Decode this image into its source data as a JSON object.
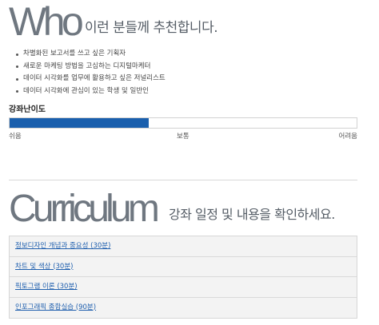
{
  "who": {
    "big_word": "Who",
    "subtitle": "이런 분들께 추천합니다.",
    "items": [
      "차별화된 보고서를 쓰고 싶은 기획자",
      "새로운 마케팅 방법을 고심하는 디지털마케터",
      "데이터 시각화를 업무에 활용하고 싶은 저널리스트",
      "데이터 시각화에 관심이 있는 학생 및 일반인"
    ]
  },
  "difficulty": {
    "title": "강좌난이도",
    "level_fraction": 0.4,
    "bar_color": "#1a5fad",
    "labels": {
      "easy": "쉬움",
      "medium": "보통",
      "hard": "어려움"
    }
  },
  "curriculum": {
    "big_word": "Curriculum",
    "subtitle": "강좌 일정 및 내용을 확인하세요.",
    "items": [
      "정보디자인 개념과 중요성 (30분)",
      "차트 및 색상 (30분)",
      "픽토그램 이론 (30분)",
      "인포그래픽 종합실습 (90분)"
    ],
    "link_color": "#1f5fae"
  }
}
